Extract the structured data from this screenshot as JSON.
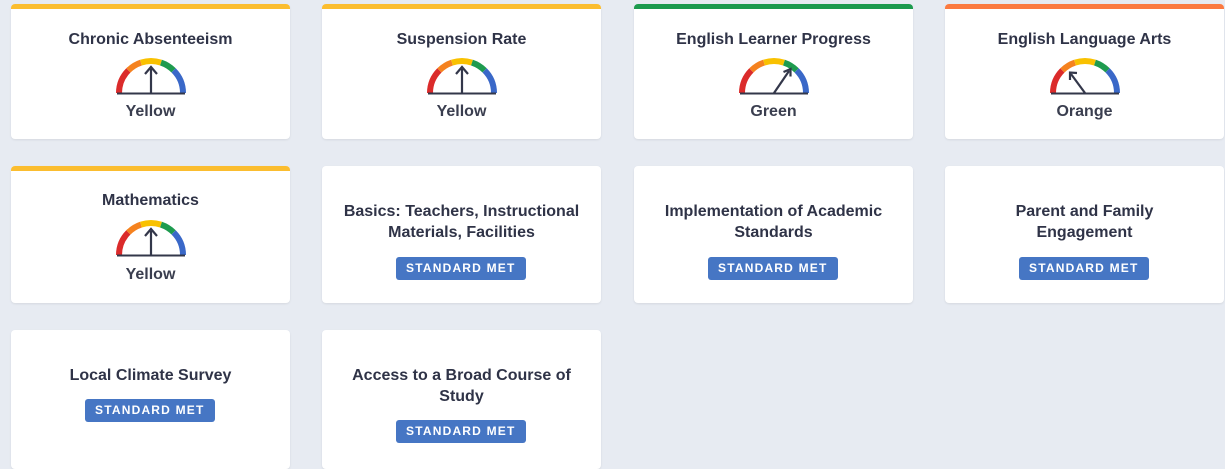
{
  "colors": {
    "yellow": "#fbbd2f",
    "green": "#1c9a4e",
    "orange": "#fb7a40",
    "badge": "#4676c4",
    "gauge_red": "#db2b2b",
    "gauge_orange": "#f5821f",
    "gauge_yellow": "#f9c100",
    "gauge_green": "#1e9b4f",
    "gauge_blue": "#3a68c8"
  },
  "cards": [
    {
      "title": "Chronic Absenteeism",
      "status": "Yellow",
      "level": "yellow"
    },
    {
      "title": "Suspension Rate",
      "status": "Yellow",
      "level": "yellow"
    },
    {
      "title": "English Learner Progress",
      "status": "Green",
      "level": "green"
    },
    {
      "title": "English Language Arts",
      "status": "Orange",
      "level": "orange"
    },
    {
      "title": "Mathematics",
      "status": "Yellow",
      "level": "yellow"
    },
    {
      "title": "Basics: Teachers, Instructional Materials, Facilities",
      "badge": "STANDARD MET"
    },
    {
      "title": "Implementation of Academic Standards",
      "badge": "STANDARD MET"
    },
    {
      "title": "Parent and Family Engagement",
      "badge": "STANDARD MET"
    },
    {
      "title": "Local Climate Survey",
      "badge": "STANDARD MET"
    },
    {
      "title": "Access to a Broad Course of Study",
      "badge": "STANDARD MET"
    }
  ]
}
